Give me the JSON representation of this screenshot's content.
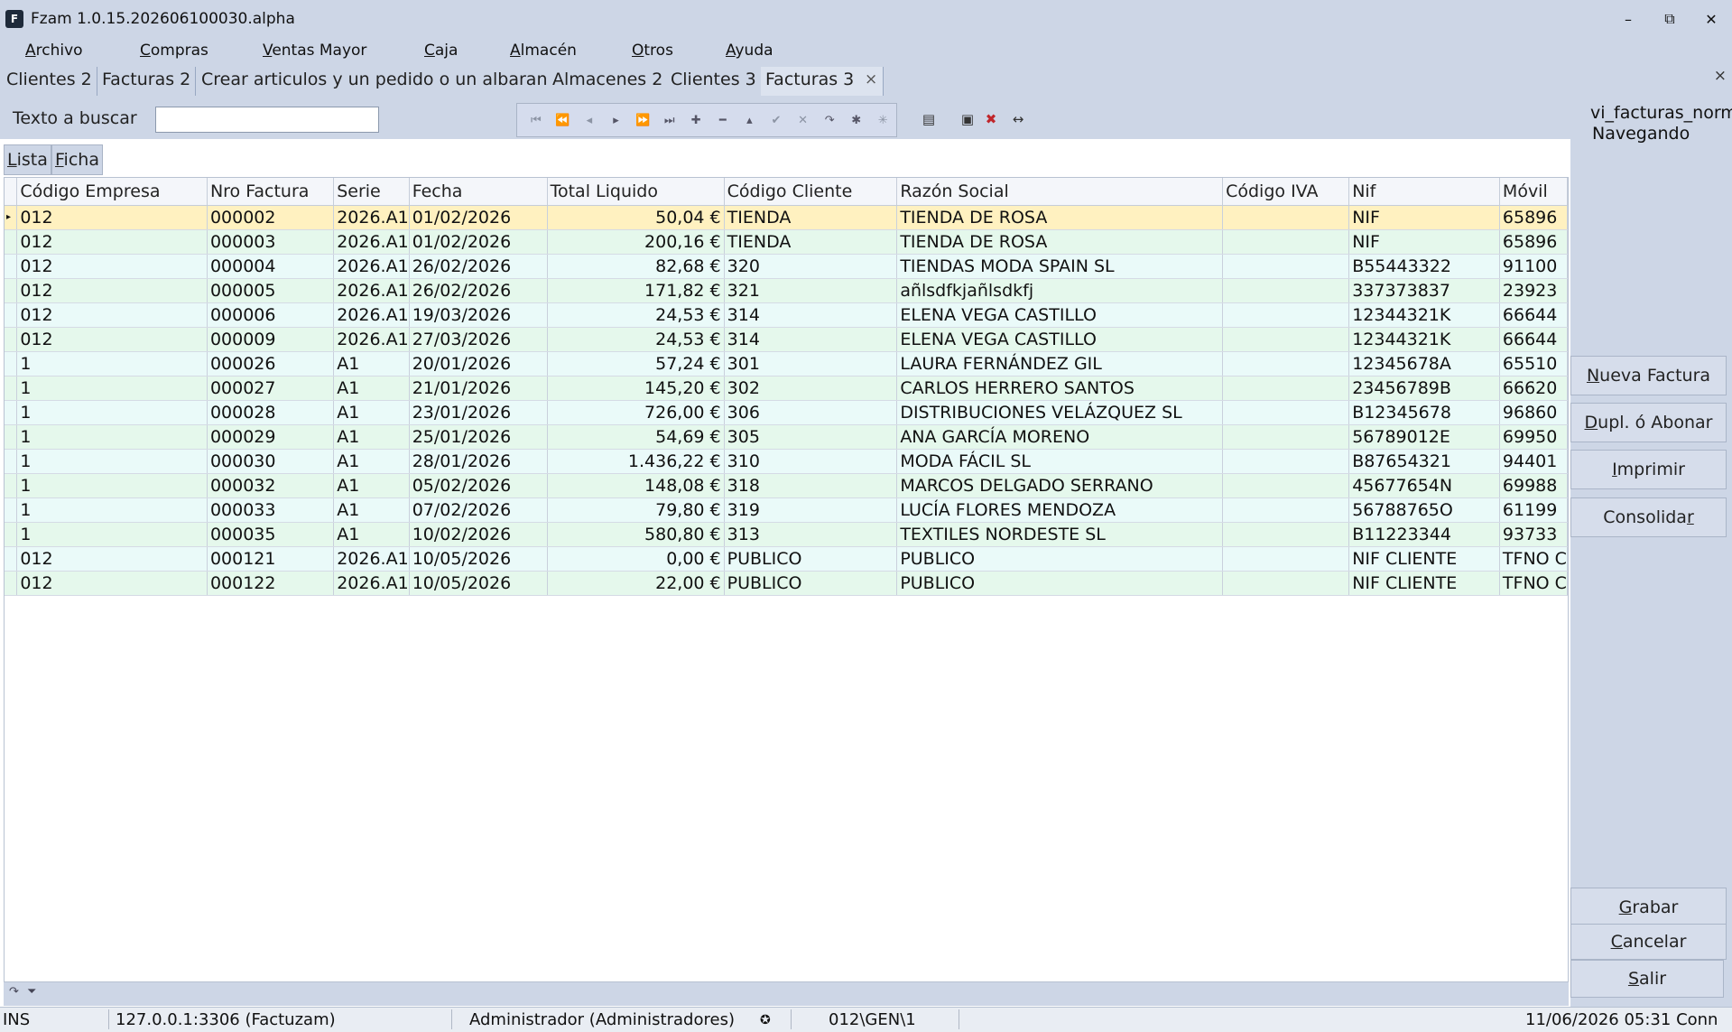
{
  "window": {
    "title": "Fzam 1.0.15.202606100030.alpha",
    "app_icon": "F",
    "minimize": "–",
    "maximize": "⧉",
    "close": "✕"
  },
  "menu": [
    {
      "key": "A",
      "rest": "rchivo"
    },
    {
      "key": "C",
      "rest": "ompras"
    },
    {
      "key": "V",
      "rest": "entas Mayor"
    },
    {
      "key": "C",
      "rest": "aja"
    },
    {
      "key": "A",
      "rest": "lmacén"
    },
    {
      "key": "O",
      "rest": "tros"
    },
    {
      "key": "A",
      "rest": "yuda"
    }
  ],
  "tabs": [
    "Clientes 2",
    "Facturas 2",
    "Crear articulos y un pedido o un albaran",
    "Almacenes 2",
    "Clientes 3",
    "Facturas 3"
  ],
  "tab_close": "×",
  "panel_close": "×",
  "search": {
    "label": "Texto a buscar",
    "value": ""
  },
  "nav_icons": [
    "first-icon",
    "prior-page-icon",
    "prior-icon",
    "next-icon",
    "next-page-icon",
    "last-icon",
    "insert-icon",
    "delete-icon",
    "edit-icon",
    "post-icon",
    "cancel-icon",
    "refresh-icon",
    "apply-icon",
    "cancel-updates-icon"
  ],
  "right": {
    "view_name": "vi_facturas_norm",
    "state": "Navegando",
    "buttons_top": [
      {
        "key": "N",
        "rest": "ueva Factura"
      },
      {
        "key": "D",
        "rest": "upl. ó Abonar"
      },
      {
        "key": "I",
        "rest": "mprimir"
      },
      {
        "pre": "Consolida",
        "key": "r",
        "rest": ""
      }
    ],
    "buttons_bottom": [
      {
        "key": "G",
        "rest": "rabar"
      },
      {
        "key": "C",
        "rest": "ancelar"
      },
      {
        "key": "S",
        "rest": "alir"
      }
    ]
  },
  "subtabs": [
    {
      "key": "L",
      "rest": "ista"
    },
    {
      "key": "F",
      "rest": "icha"
    }
  ],
  "grid": {
    "columns": [
      "Código Empresa",
      "Nro Factura",
      "Serie",
      "Fecha",
      "Total Liquido",
      "Código Cliente",
      "Razón Social",
      "Código IVA",
      "Nif",
      "Móvil"
    ],
    "rows": [
      [
        "012",
        "000002",
        "2026.A1",
        "01/02/2026",
        "50,04 €",
        "TIENDA",
        "TIENDA DE ROSA",
        "",
        "NIF",
        "65896"
      ],
      [
        "012",
        "000003",
        "2026.A1",
        "01/02/2026",
        "200,16 €",
        "TIENDA",
        "TIENDA DE ROSA",
        "",
        "NIF",
        "65896"
      ],
      [
        "012",
        "000004",
        "2026.A1",
        "26/02/2026",
        "82,68 €",
        "320",
        "TIENDAS MODA SPAIN SL",
        "",
        "B55443322",
        "91100"
      ],
      [
        "012",
        "000005",
        "2026.A1",
        "26/02/2026",
        "171,82 €",
        "321",
        "añlsdfkjañlsdkfj",
        "",
        "337373837",
        "23923"
      ],
      [
        "012",
        "000006",
        "2026.A1",
        "19/03/2026",
        "24,53 €",
        "314",
        "ELENA VEGA CASTILLO",
        "",
        "12344321K",
        "66644"
      ],
      [
        "012",
        "000009",
        "2026.A1",
        "27/03/2026",
        "24,53 €",
        "314",
        "ELENA VEGA CASTILLO",
        "",
        "12344321K",
        "66644"
      ],
      [
        "1",
        "000026",
        "A1",
        "20/01/2026",
        "57,24 €",
        "301",
        "LAURA FERNÁNDEZ GIL",
        "",
        "12345678A",
        "65510"
      ],
      [
        "1",
        "000027",
        "A1",
        "21/01/2026",
        "145,20 €",
        "302",
        "CARLOS HERRERO SANTOS",
        "",
        "23456789B",
        "66620"
      ],
      [
        "1",
        "000028",
        "A1",
        "23/01/2026",
        "726,00 €",
        "306",
        "DISTRIBUCIONES VELÁZQUEZ SL",
        "",
        "B12345678",
        "96860"
      ],
      [
        "1",
        "000029",
        "A1",
        "25/01/2026",
        "54,69 €",
        "305",
        "ANA GARCÍA MORENO",
        "",
        "56789012E",
        "69950"
      ],
      [
        "1",
        "000030",
        "A1",
        "28/01/2026",
        "1.436,22 €",
        "310",
        "MODA FÁCIL SL",
        "",
        "B87654321",
        "94401"
      ],
      [
        "1",
        "000032",
        "A1",
        "05/02/2026",
        "148,08 €",
        "318",
        "MARCOS DELGADO SERRANO",
        "",
        "45677654N",
        "69988"
      ],
      [
        "1",
        "000033",
        "A1",
        "07/02/2026",
        "79,80 €",
        "319",
        "LUCÍA FLORES MENDOZA",
        "",
        "56788765O",
        "61199"
      ],
      [
        "1",
        "000035",
        "A1",
        "10/02/2026",
        "580,80 €",
        "313",
        "TEXTILES NORDESTE SL",
        "",
        "B11223344",
        "93733"
      ],
      [
        "012",
        "000121",
        "2026.A1",
        "10/05/2026",
        "0,00 €",
        "PUBLICO",
        "PUBLICO",
        "",
        "NIF CLIENTE",
        "TFNO C"
      ],
      [
        "012",
        "000122",
        "2026.A1",
        "10/05/2026",
        "22,00 €",
        "PUBLICO",
        "PUBLICO",
        "",
        "NIF CLIENTE",
        "TFNO C"
      ]
    ],
    "selected_row": 0,
    "row_indicator": "▸"
  },
  "status": {
    "mode": "INS",
    "connection": "127.0.0.1:3306 (Factuzam)",
    "user": "Administrador (Administradores)",
    "user_icon": "✪",
    "path": "012\\GEN\\1",
    "datetime": "11/06/2026 05:31 Conn"
  },
  "colors": {
    "chrome": "#cdd6e6",
    "row_odd": "#eafaf9",
    "row_even": "#e5f8ec",
    "row_selected": "#fff1c0"
  }
}
